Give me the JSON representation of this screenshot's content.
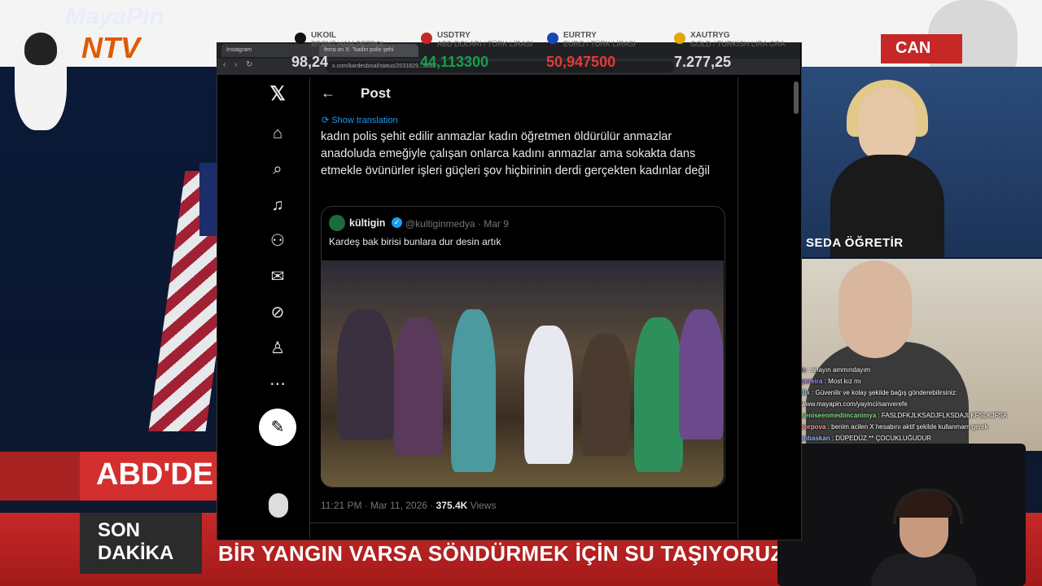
{
  "ticker": [
    {
      "symbol": "UKOIL",
      "desc": "BRENT HAM PETROL",
      "value": "98,24",
      "color": "#222222"
    },
    {
      "symbol": "USDTRY",
      "desc": "ABD DOLARI / TÜRK LİRASI",
      "value": "44,113300",
      "color": "#12a04a"
    },
    {
      "symbol": "EURTRY",
      "desc": "EURO / TÜRK LİRASI",
      "value": "50,947500",
      "color": "#d32f2f"
    },
    {
      "symbol": "XAUTRYG",
      "desc": "GOLD / TURKISH LIRA GRA",
      "value": "7.277,25",
      "color": "#222222"
    }
  ],
  "logo": {
    "top": "MayaPin",
    "bottom": "NTV"
  },
  "tv": {
    "abd_fragment": "ABD'DE",
    "son_dakika_line1": "SON",
    "son_dakika_line2": "DAKİKA",
    "headline": "BİR YANGIN VARSA SÖNDÜRMEK İÇİN SU TAŞIYORUZ",
    "cam_badge": "CAN",
    "anchor_name": "SEDA ÖĞRETİR"
  },
  "browser": {
    "tabs": [
      "Instagram",
      "ferra on X: \"kadın polis şehi"
    ],
    "url": "x.com/kardesbisal/status/2031829...5553"
  },
  "x": {
    "page_title": "Post",
    "show_translation": "Show translation",
    "tweet_text": "kadın polis şehit edilir anmazlar kadın öğretmen öldürülür anmazlar anadoluda emeğiyle çalışan onlarca kadını anmazlar ama sokakta dans etmekle övünürler işleri güçleri şov hiçbirinin derdi gerçekten kadınlar değil",
    "quote": {
      "name": "kültigin",
      "handle": "@kultiginmedya · Mar 9",
      "text": "Kardeş bak birisi bunlara dur desin artık"
    },
    "time": "11:21 PM · Mar 11, 2026 · ",
    "views_count": "375.4K",
    "views_label": " Views"
  },
  "chat": [
    {
      "user": "aycis",
      "msg": " : anayın ammındayım",
      "color": "#e08ae0"
    },
    {
      "user": "edapereira",
      "msg": " : Most kız mı",
      "color": "#b08aff"
    },
    {
      "user": "@LiveJix",
      "msg": " : Güvenilir ve kolay şekilde bağış gönderebilirsiniz:",
      "color": "#7fd0ff"
    },
    {
      "user": "",
      "msg": "https://www.mayapin.com/yayinci/sanverefe",
      "color": "#ffffff"
    },
    {
      "user": "benseniseenmedimcanimya",
      "msg": " : FASLDFKJLKSADJFLKSDAJLKFSLKJFSA",
      "color": "#7fe07f"
    },
    {
      "user": "yassorpova",
      "msg": " : benim acilen X hesabını aktif şekilde kullanmam gerek",
      "color": "#ff9a9a"
    },
    {
      "user": "Emirhanbaskan",
      "msg": " : DÜPEDÜZ ** ÇOCUKLUĞUDUR",
      "color": "#9ab0ff"
    }
  ]
}
